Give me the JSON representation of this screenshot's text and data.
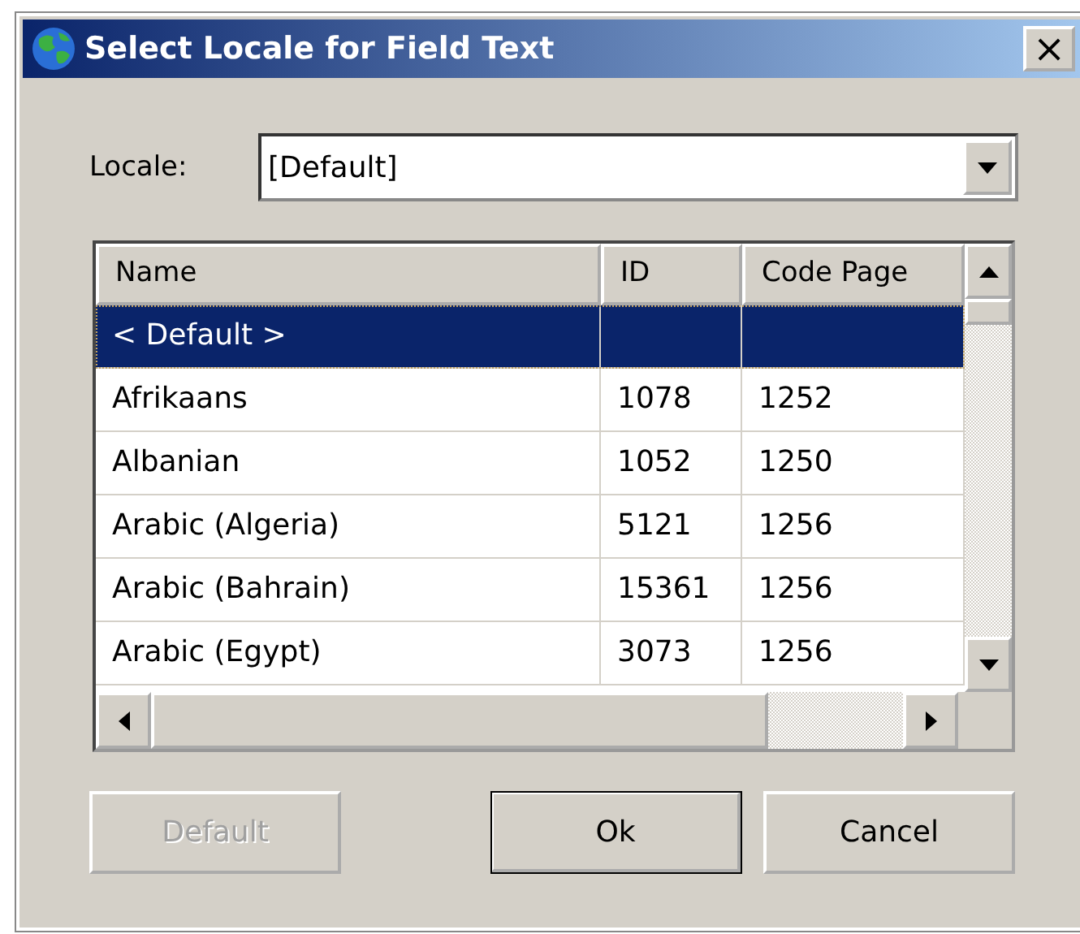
{
  "window": {
    "title": "Select Locale for Field Text",
    "close": "×"
  },
  "locale": {
    "label": "Locale:",
    "value": "[Default]"
  },
  "table": {
    "columns": [
      "Name",
      "ID",
      "Code Page"
    ],
    "rows": [
      {
        "cells": [
          "< Default >",
          "",
          ""
        ],
        "selected": true
      },
      {
        "cells": [
          "Afrikaans",
          "1078",
          "1252"
        ],
        "selected": false
      },
      {
        "cells": [
          "Albanian",
          "1052",
          "1250"
        ],
        "selected": false
      },
      {
        "cells": [
          "Arabic (Algeria)",
          "5121",
          "1256"
        ],
        "selected": false
      },
      {
        "cells": [
          "Arabic (Bahrain)",
          "15361",
          "1256"
        ],
        "selected": false
      },
      {
        "cells": [
          "Arabic (Egypt)",
          "3073",
          "1256"
        ],
        "selected": false
      }
    ]
  },
  "buttons": [
    {
      "label": "Default",
      "disabled": true,
      "default": false
    },
    {
      "label": "Ok",
      "disabled": false,
      "default": true
    },
    {
      "label": "Cancel",
      "disabled": false,
      "default": false
    }
  ]
}
